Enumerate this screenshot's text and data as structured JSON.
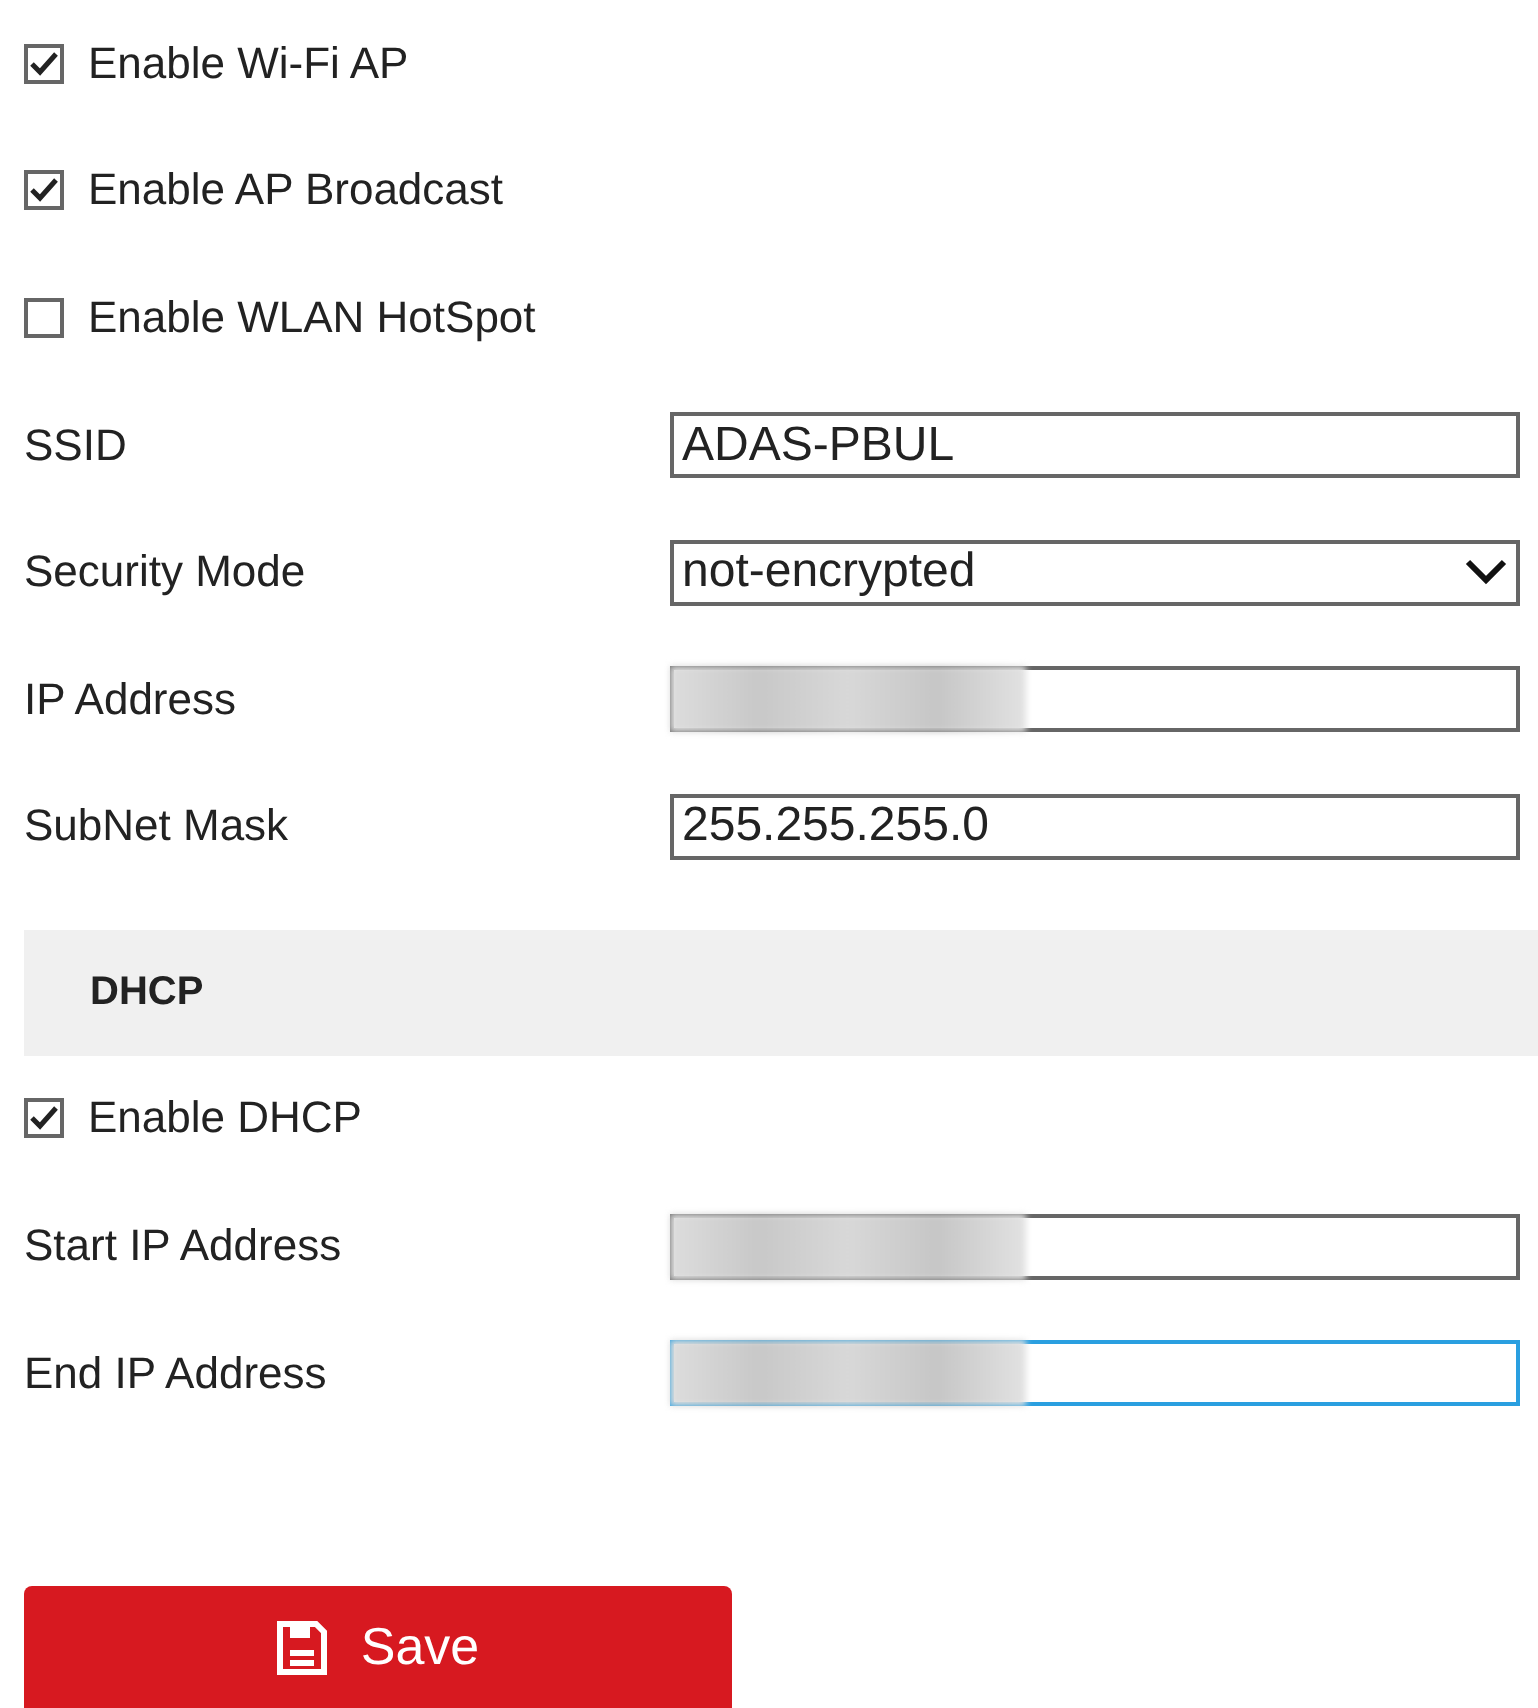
{
  "checkboxes": [
    {
      "label": "Enable Wi-Fi AP",
      "checked": true
    },
    {
      "label": "Enable AP Broadcast",
      "checked": true
    },
    {
      "label": "Enable WLAN HotSpot",
      "checked": false
    }
  ],
  "fields": [
    {
      "label": "SSID",
      "kind": "text",
      "value": "ADAS-PBUL",
      "redacted": false,
      "focused": false
    },
    {
      "label": "Security Mode",
      "kind": "select",
      "value": "not-encrypted",
      "redacted": false,
      "focused": false
    },
    {
      "label": "IP Address",
      "kind": "text",
      "redacted": true,
      "focused": false
    },
    {
      "label": "SubNet Mask",
      "kind": "text",
      "value": "255.255.255.0",
      "redacted": false,
      "focused": false
    }
  ],
  "dhcp": {
    "title": "DHCP",
    "enable": {
      "label": "Enable DHCP",
      "checked": true
    },
    "fields": [
      {
        "label": "Start IP Address",
        "kind": "text",
        "redacted": true,
        "focused": false
      },
      {
        "label": "End IP Address",
        "kind": "text",
        "redacted": true,
        "focused": true
      }
    ]
  },
  "save_button": {
    "label": "Save"
  }
}
